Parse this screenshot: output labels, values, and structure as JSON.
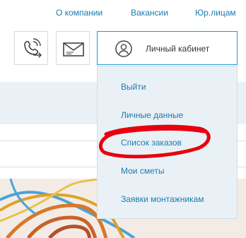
{
  "topnav": {
    "links": [
      "О компании",
      "Вакансии",
      "Юр.лицам"
    ]
  },
  "header": {
    "callback_icon": "phone-callback-icon",
    "mail_icon": "envelope-icon",
    "account": {
      "icon": "user-avatar-icon",
      "label": "Личный кабинет"
    }
  },
  "account_menu": {
    "items": [
      "Выйти",
      "Личные данные",
      "Список заказов",
      "Мои сметы",
      "Заявки монтажникам"
    ],
    "highlighted": "Список заказов",
    "highlight_color": "#e8000e"
  },
  "colors": {
    "link": "#1a7bb0",
    "accent_border": "#1f9ccf",
    "panel_bg": "#e9f1f6"
  }
}
